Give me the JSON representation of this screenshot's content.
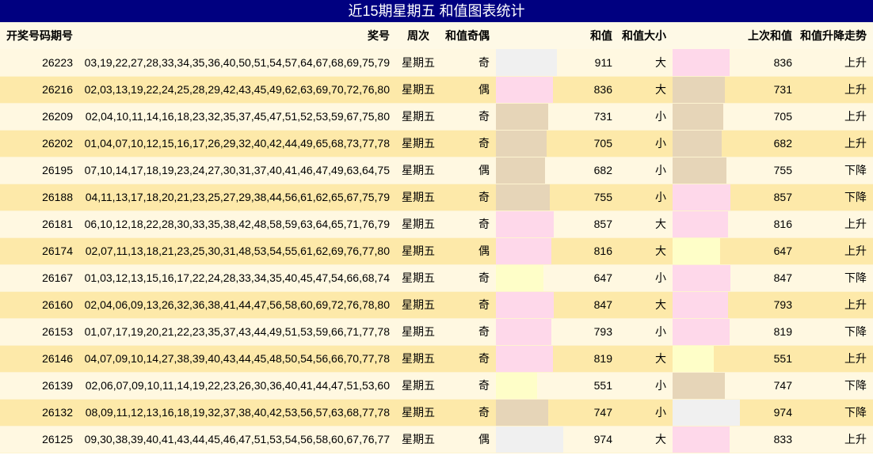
{
  "title": "近15期星期五 和值图表统计",
  "headers": {
    "issue": "开奖号码期号",
    "numbers": "奖号",
    "weekday": "周次",
    "parity": "和值奇偶",
    "sum": "和值",
    "size": "和值大小",
    "prev_sum": "上次和值",
    "trend": "和值升降走势"
  },
  "colors": {
    "title_bg": "#000080",
    "row_light": "#fff8e1",
    "row_dark": "#fde9a9",
    "bar_pink": "#fed8ea",
    "bar_tan": "#e6d5b8",
    "bar_yellow": "#fefec8",
    "bar_gray": "#f0f0f0"
  },
  "rows": [
    {
      "issue": "26223",
      "numbers": "03,19,22,27,28,33,34,35,36,40,50,51,54,57,64,67,68,69,75,79",
      "weekday": "星期五",
      "parity": "奇",
      "sum": "911",
      "sum_color": "#f0f0f0",
      "sum_level": 0.59,
      "size": "大",
      "prev": "836",
      "prev_color": "#fed8ea",
      "prev_level": 0.55,
      "trend": "上升"
    },
    {
      "issue": "26216",
      "numbers": "02,03,13,19,22,24,25,28,29,42,43,45,49,62,63,69,70,72,76,80",
      "weekday": "星期五",
      "parity": "偶",
      "sum": "836",
      "sum_color": "#fed8ea",
      "sum_level": 0.55,
      "size": "大",
      "prev": "731",
      "prev_color": "#e6d5b8",
      "prev_level": 0.51,
      "trend": "上升"
    },
    {
      "issue": "26209",
      "numbers": "02,04,10,11,14,16,18,23,32,35,37,45,47,51,52,53,59,67,75,80",
      "weekday": "星期五",
      "parity": "奇",
      "sum": "731",
      "sum_color": "#e6d5b8",
      "sum_level": 0.51,
      "size": "小",
      "prev": "705",
      "prev_color": "#e6d5b8",
      "prev_level": 0.49,
      "trend": "上升"
    },
    {
      "issue": "26202",
      "numbers": "01,04,07,10,12,15,16,17,26,29,32,40,42,44,49,65,68,73,77,78",
      "weekday": "星期五",
      "parity": "奇",
      "sum": "705",
      "sum_color": "#e6d5b8",
      "sum_level": 0.49,
      "size": "小",
      "prev": "682",
      "prev_color": "#e6d5b8",
      "prev_level": 0.48,
      "trend": "上升"
    },
    {
      "issue": "26195",
      "numbers": "07,10,14,17,18,19,23,24,27,30,31,37,40,41,46,47,49,63,64,75",
      "weekday": "星期五",
      "parity": "偶",
      "sum": "682",
      "sum_color": "#e6d5b8",
      "sum_level": 0.48,
      "size": "小",
      "prev": "755",
      "prev_color": "#e6d5b8",
      "prev_level": 0.52,
      "trend": "下降"
    },
    {
      "issue": "26188",
      "numbers": "04,11,13,17,18,20,21,23,25,27,29,38,44,56,61,62,65,67,75,79",
      "weekday": "星期五",
      "parity": "奇",
      "sum": "755",
      "sum_color": "#e6d5b8",
      "sum_level": 0.52,
      "size": "小",
      "prev": "857",
      "prev_color": "#fed8ea",
      "prev_level": 0.56,
      "trend": "下降"
    },
    {
      "issue": "26181",
      "numbers": "06,10,12,18,22,28,30,33,35,38,42,48,58,59,63,64,65,71,76,79",
      "weekday": "星期五",
      "parity": "奇",
      "sum": "857",
      "sum_color": "#fed8ea",
      "sum_level": 0.56,
      "size": "大",
      "prev": "816",
      "prev_color": "#fed8ea",
      "prev_level": 0.54,
      "trend": "上升"
    },
    {
      "issue": "26174",
      "numbers": "02,07,11,13,18,21,23,25,30,31,48,53,54,55,61,62,69,76,77,80",
      "weekday": "星期五",
      "parity": "偶",
      "sum": "816",
      "sum_color": "#fed8ea",
      "sum_level": 0.54,
      "size": "大",
      "prev": "647",
      "prev_color": "#fefec8",
      "prev_level": 0.46,
      "trend": "上升"
    },
    {
      "issue": "26167",
      "numbers": "01,03,12,13,15,16,17,22,24,28,33,34,35,40,45,47,54,66,68,74",
      "weekday": "星期五",
      "parity": "奇",
      "sum": "647",
      "sum_color": "#fefec8",
      "sum_level": 0.46,
      "size": "小",
      "prev": "847",
      "prev_color": "#fed8ea",
      "prev_level": 0.56,
      "trend": "下降"
    },
    {
      "issue": "26160",
      "numbers": "02,04,06,09,13,26,32,36,38,41,44,47,56,58,60,69,72,76,78,80",
      "weekday": "星期五",
      "parity": "奇",
      "sum": "847",
      "sum_color": "#fed8ea",
      "sum_level": 0.56,
      "size": "大",
      "prev": "793",
      "prev_color": "#fed8ea",
      "prev_level": 0.54,
      "trend": "上升"
    },
    {
      "issue": "26153",
      "numbers": "01,07,17,19,20,21,22,23,35,37,43,44,49,51,53,59,66,71,77,78",
      "weekday": "星期五",
      "parity": "奇",
      "sum": "793",
      "sum_color": "#fed8ea",
      "sum_level": 0.54,
      "size": "小",
      "prev": "819",
      "prev_color": "#fed8ea",
      "prev_level": 0.55,
      "trend": "下降"
    },
    {
      "issue": "26146",
      "numbers": "04,07,09,10,14,27,38,39,40,43,44,45,48,50,54,56,66,70,77,78",
      "weekday": "星期五",
      "parity": "奇",
      "sum": "819",
      "sum_color": "#fed8ea",
      "sum_level": 0.55,
      "size": "大",
      "prev": "551",
      "prev_color": "#fefec8",
      "prev_level": 0.4,
      "trend": "上升"
    },
    {
      "issue": "26139",
      "numbers": "02,06,07,09,10,11,14,19,22,23,26,30,36,40,41,44,47,51,53,60",
      "weekday": "星期五",
      "parity": "奇",
      "sum": "551",
      "sum_color": "#fefec8",
      "sum_level": 0.4,
      "size": "小",
      "prev": "747",
      "prev_color": "#e6d5b8",
      "prev_level": 0.51,
      "trend": "下降"
    },
    {
      "issue": "26132",
      "numbers": "08,09,11,12,13,16,18,19,32,37,38,40,42,53,56,57,63,68,77,78",
      "weekday": "星期五",
      "parity": "奇",
      "sum": "747",
      "sum_color": "#e6d5b8",
      "sum_level": 0.51,
      "size": "小",
      "prev": "974",
      "prev_color": "#f0f0f0",
      "prev_level": 0.65,
      "trend": "下降"
    },
    {
      "issue": "26125",
      "numbers": "09,30,38,39,40,41,43,44,45,46,47,51,53,54,56,58,60,67,76,77",
      "weekday": "星期五",
      "parity": "偶",
      "sum": "974",
      "sum_color": "#f0f0f0",
      "sum_level": 0.65,
      "size": "大",
      "prev": "833",
      "prev_color": "#fed8ea",
      "prev_level": 0.55,
      "trend": "上升"
    }
  ]
}
